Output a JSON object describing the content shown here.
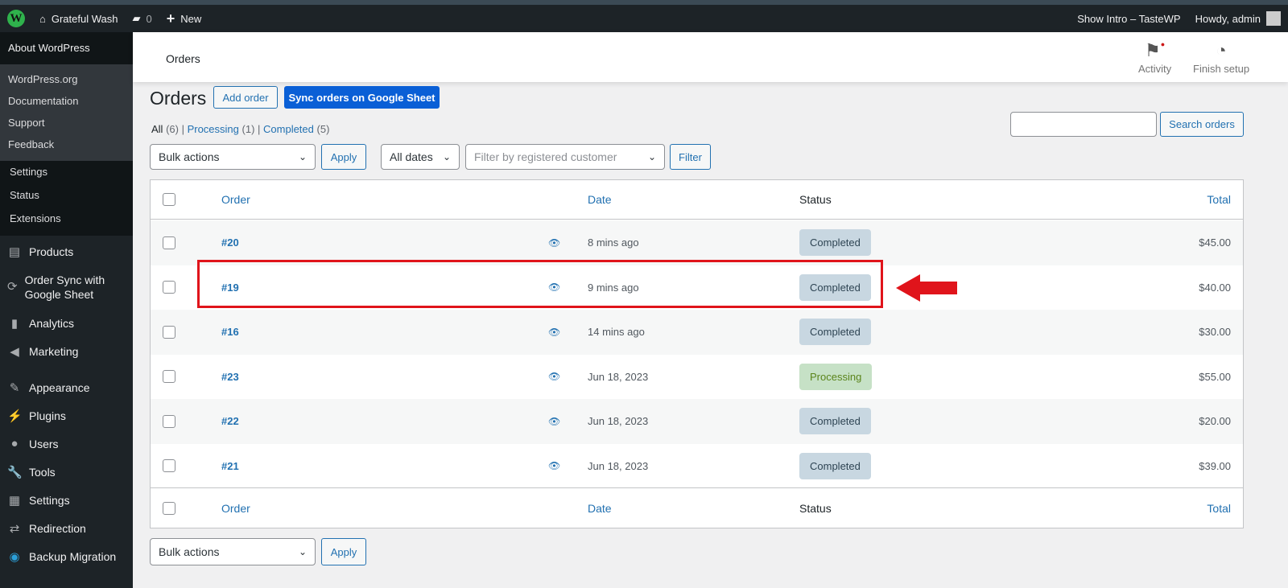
{
  "adminbar": {
    "site": "Grateful Wash",
    "comments": "0",
    "new": "New",
    "intro": "Show Intro – TasteWP",
    "howdy": "Howdy, admin"
  },
  "sidebar": {
    "about": "About WordPress",
    "links": [
      "WordPress.org",
      "Documentation",
      "Support",
      "Feedback"
    ],
    "wc_sub": [
      "Settings",
      "Status",
      "Extensions"
    ],
    "menu": [
      {
        "label": "Products",
        "icon": "box-icon"
      },
      {
        "label": "Order Sync with Google Sheet",
        "icon": "sync-icon"
      },
      {
        "label": "Analytics",
        "icon": "chart-icon"
      },
      {
        "label": "Marketing",
        "icon": "megaphone-icon"
      },
      {
        "label": "Appearance",
        "icon": "brush-icon"
      },
      {
        "label": "Plugins",
        "icon": "plug-icon"
      },
      {
        "label": "Users",
        "icon": "user-icon"
      },
      {
        "label": "Tools",
        "icon": "wrench-icon"
      },
      {
        "label": "Settings",
        "icon": "settings-icon"
      },
      {
        "label": "Redirection",
        "icon": "redirect-icon"
      },
      {
        "label": "Backup Migration",
        "icon": "backup-icon"
      }
    ]
  },
  "header": {
    "title": "Orders",
    "activity": "Activity",
    "finish": "Finish setup"
  },
  "page": {
    "title": "Orders",
    "add": "Add order",
    "sync": "Sync orders on Google Sheet",
    "filters": {
      "all": "All",
      "all_count": "(6)",
      "processing": "Processing",
      "processing_count": "(1)",
      "completed": "Completed",
      "completed_count": "(5)"
    },
    "bulk": "Bulk actions",
    "apply": "Apply",
    "dates": "All dates",
    "customer_placeholder": "Filter by registered customer",
    "filter": "Filter",
    "search": "Search orders"
  },
  "table": {
    "columns": {
      "order": "Order",
      "date": "Date",
      "status": "Status",
      "total": "Total"
    },
    "rows": [
      {
        "order": "#20",
        "date": "8 mins ago",
        "status": "Completed",
        "total": "$45.00"
      },
      {
        "order": "#19",
        "date": "9 mins ago",
        "status": "Completed",
        "total": "$40.00"
      },
      {
        "order": "#16",
        "date": "14 mins ago",
        "status": "Completed",
        "total": "$30.00"
      },
      {
        "order": "#23",
        "date": "Jun 18, 2023",
        "status": "Processing",
        "total": "$55.00"
      },
      {
        "order": "#22",
        "date": "Jun 18, 2023",
        "status": "Completed",
        "total": "$20.00"
      },
      {
        "order": "#21",
        "date": "Jun 18, 2023",
        "status": "Completed",
        "total": "$39.00"
      }
    ]
  },
  "colors": {
    "highlight": "#e0141b",
    "accent": "#2271b1"
  }
}
